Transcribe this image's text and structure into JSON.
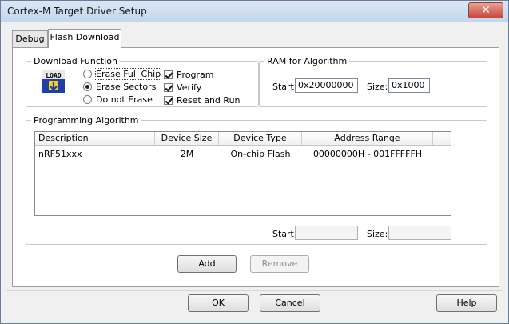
{
  "window": {
    "title": "Cortex-M Target Driver Setup",
    "close": "✕"
  },
  "tabs": [
    {
      "label": "Debug"
    },
    {
      "label": "Flash Download"
    }
  ],
  "download_function": {
    "legend": "Download Function",
    "icon_text": "LOAD",
    "options": {
      "erase_full": "Erase Full Chip",
      "erase_sectors": "Erase Sectors",
      "no_erase": "Do not Erase"
    },
    "selected": "erase_sectors",
    "checks": {
      "program": "Program",
      "verify": "Verify",
      "reset": "Reset and Run"
    }
  },
  "ram": {
    "legend": "RAM for Algorithm",
    "start_label": "Start:",
    "start_value": "0x20000000",
    "size_label": "Size:",
    "size_value": "0x1000"
  },
  "algorithm": {
    "legend": "Programming Algorithm",
    "columns": [
      "Description",
      "Device Size",
      "Device Type",
      "Address Range"
    ],
    "rows": [
      [
        "nRF51xxx",
        "2M",
        "On-chip Flash",
        "00000000H - 001FFFFFH"
      ]
    ],
    "start_label": "Start:",
    "start_value": "",
    "size_label": "Size:",
    "size_value": ""
  },
  "buttons": {
    "add": "Add",
    "remove": "Remove",
    "ok": "OK",
    "cancel": "Cancel",
    "help": "Help"
  }
}
